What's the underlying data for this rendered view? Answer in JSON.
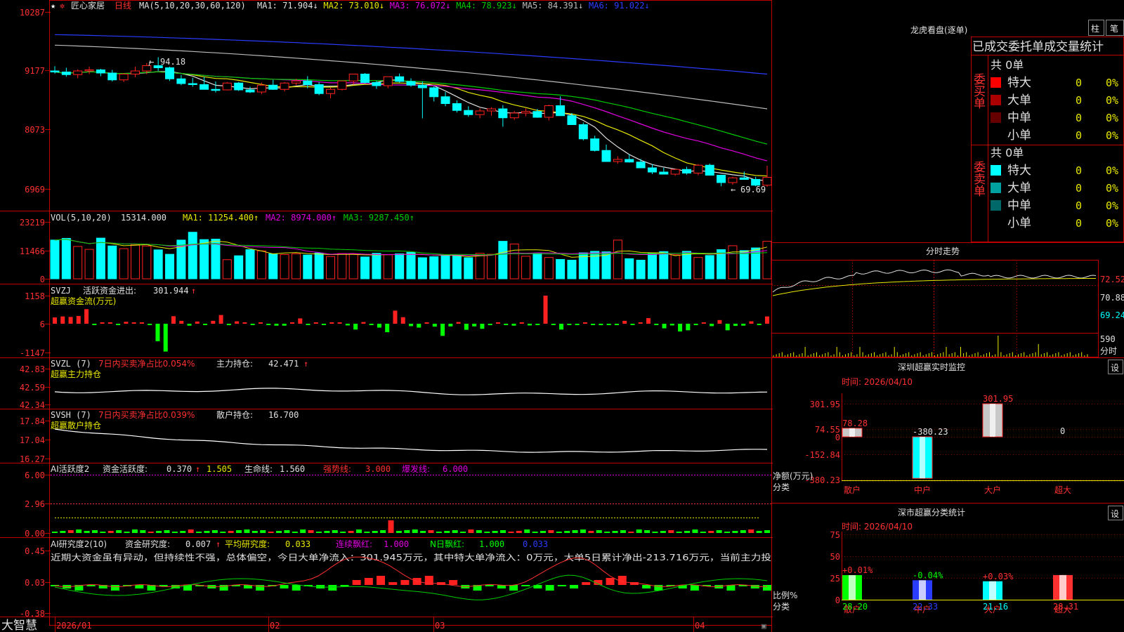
{
  "stock": {
    "name": "匠心家居",
    "period": "日线",
    "ma_header": "MA(5,10,20,30,60,120)",
    "ma_items": [
      {
        "label": "MA1:",
        "value": "71.904",
        "arrow": "↓",
        "color": "#e0e0e0"
      },
      {
        "label": "MA2:",
        "value": "73.010",
        "arrow": "↓",
        "color": "#e8e800"
      },
      {
        "label": "MA3:",
        "value": "76.072",
        "arrow": "↓",
        "color": "#e000e0"
      },
      {
        "label": "MA4:",
        "value": "78.923",
        "arrow": "↓",
        "color": "#00cc00"
      },
      {
        "label": "MA5:",
        "value": "84.391",
        "arrow": "↓",
        "color": "#bbbbbb"
      },
      {
        "label": "MA6:",
        "value": "91.022",
        "arrow": "↓",
        "color": "#2a3cff"
      }
    ],
    "high_label": "94.18",
    "low_label": "69.69"
  },
  "price_axis": [
    "10287",
    "9177",
    "8073",
    "6969"
  ],
  "price_range": [
    66.0,
    104.0
  ],
  "colors": {
    "up": "#ff2020",
    "down": "#00ffff",
    "frame": "#c00000",
    "grid": "#800000"
  },
  "vol_panel": {
    "header": "VOL(5,10,20)",
    "value": "15314.000",
    "items": [
      {
        "label": "MA1:",
        "value": "11254.400",
        "arrow": "↑",
        "color": "#e8e800"
      },
      {
        "label": "MA2:",
        "value": "8974.000",
        "arrow": "↑",
        "color": "#e000e0"
      },
      {
        "label": "MA3:",
        "value": "9287.450",
        "arrow": "↑",
        "color": "#00cc00"
      }
    ],
    "axis": [
      "23219",
      "11466",
      "0"
    ]
  },
  "svzj_panel": {
    "header": "SVZJ",
    "label": "活跃资金进出:",
    "value": "301.944",
    "arrow": "↑",
    "subtitle": "超赢资金流(万元)",
    "axis": [
      "1158",
      "6",
      "-1147"
    ]
  },
  "svzl_panel": {
    "header": "SVZL (7)",
    "text1": "7日内买卖净占比0.054%",
    "label": "主力持仓:",
    "value": "42.471",
    "arrow": "↑",
    "subtitle": "超赢主力持仓",
    "axis": [
      "42.83",
      "42.59",
      "42.34"
    ]
  },
  "svsh_panel": {
    "header": "SVSH (7)",
    "text1": "7日内买卖净占比0.039%",
    "label": "散户持仓:",
    "value": "16.700",
    "arrow": "↑",
    "subtitle": "超赢散户持仓",
    "axis": [
      "17.84",
      "17.04",
      "16.27"
    ]
  },
  "ai_active_panel": {
    "header": "AI活跃度2",
    "label": "资金活跃度:",
    "value": "0.370",
    "arrow": "↑",
    "value2": "1.505",
    "label3": "生命线:",
    "value3": "1.560",
    "label4": "强势线:",
    "value4": "3.000",
    "label5": "爆发线:",
    "value5": "6.000",
    "axis": [
      "6.00",
      "2.96",
      "0.00"
    ]
  },
  "ai_research_panel": {
    "header": "AI研究度2(10)",
    "label": "资金研究度:",
    "value": "0.007",
    "arrow": "↑",
    "label2": "平均研究度:",
    "value2": "0.033",
    "label3": "连续飘红:",
    "value3": "1.000",
    "label4": "N日飘红:",
    "value4": "1.000",
    "value5": "0.033",
    "comment": "近期大资金虽有异动，但持续性不强，总体偏空，今日大单净流入：301.945万元，其中特大单净流入：0万元，大单5日累计净出-213.716万元，当前主力投",
    "axis": [
      "0.45",
      "0.03",
      "-0.38"
    ]
  },
  "date_axis": [
    "2026/01",
    "02",
    "03",
    "04"
  ],
  "brand": "大智慧",
  "right": {
    "dragon_title": "龙虎看盘(逐单)",
    "tab1": "柱",
    "tab2": "笔",
    "stat_title": "已成交委托单成交量统计",
    "buy_side": {
      "label": "委买单",
      "total": "共 0单",
      "rows": [
        {
          "name": "特大",
          "value": "0",
          "pct": "0%",
          "color": "#ff0000"
        },
        {
          "name": "大单",
          "value": "0",
          "pct": "0%",
          "color": "#aa0000"
        },
        {
          "name": "中单",
          "value": "0",
          "pct": "0%",
          "color": "#660000"
        },
        {
          "name": "小单",
          "value": "0",
          "pct": "0%",
          "color": "#000000"
        }
      ]
    },
    "sell_side": {
      "label": "委卖单",
      "total": "共 0单",
      "rows": [
        {
          "name": "特大",
          "value": "0",
          "pct": "0%",
          "color": "#00ffff"
        },
        {
          "name": "大单",
          "value": "0",
          "pct": "0%",
          "color": "#00a0a0"
        },
        {
          "name": "中单",
          "value": "0",
          "pct": "0%",
          "color": "#006868"
        },
        {
          "name": "小单",
          "value": "0",
          "pct": "0%",
          "color": "#000000"
        }
      ]
    },
    "intraday_title": "分时走势",
    "intraday_axis": [
      "72.52",
      "70.88",
      "69.24"
    ],
    "intraday_vol_axis": [
      "590",
      "分时"
    ],
    "monitor": {
      "title": "深圳超赢实时监控",
      "set": "设",
      "time": "时间: 2026/04/10",
      "axis": [
        "301.95",
        "74.55",
        "0",
        "-152.84",
        "-380.23"
      ],
      "ylabel": "净额(万元)",
      "xlabel": "分类",
      "categories": [
        "散户",
        "中户",
        "大户",
        "超大"
      ],
      "values": [
        78.28,
        -380.23,
        301.95,
        0
      ],
      "value_labels": [
        "78.28",
        "-380.23",
        "301.95",
        "0"
      ]
    },
    "classify": {
      "title": "深市超赢分类统计",
      "set": "设",
      "time": "时间: 2026/04/10",
      "axis": [
        "75",
        "50",
        "25",
        "0"
      ],
      "ylabel": "比例%",
      "xlabel": "分类",
      "categories": [
        "散户",
        "中户",
        "大户",
        "超大"
      ],
      "values": [
        28.2,
        22.33,
        21.16,
        28.31
      ],
      "changes": [
        "+0.01%",
        "-0.04%",
        "+0.03%",
        ""
      ],
      "value_labels": [
        "28.20",
        "22.33",
        "21.16",
        "28.31"
      ]
    }
  },
  "chart_data": [
    {
      "type": "candlestick",
      "title": "匠心家居 日线",
      "x": [
        "2026/01",
        "02",
        "03",
        "04"
      ],
      "ohlc": [
        [
          91.6,
          92.5,
          91.1,
          91.4
        ],
        [
          91.4,
          92.2,
          90.5,
          90.9
        ],
        [
          90.9,
          91.9,
          90.2,
          91.6
        ],
        [
          91.6,
          92.4,
          91.0,
          91.8
        ],
        [
          91.8,
          92.0,
          90.6,
          91.2
        ],
        [
          91.2,
          91.8,
          89.6,
          89.9
        ],
        [
          89.9,
          91.2,
          89.5,
          91.0
        ],
        [
          91.0,
          92.4,
          90.4,
          91.6
        ],
        [
          91.6,
          93.1,
          91.0,
          92.6
        ],
        [
          92.6,
          94.2,
          91.6,
          92.2
        ],
        [
          92.2,
          92.4,
          89.7,
          90.1
        ],
        [
          90.1,
          90.8,
          88.9,
          89.2
        ],
        [
          89.2,
          90.3,
          88.6,
          89.0
        ],
        [
          89.0,
          90.5,
          88.2,
          88.1
        ],
        [
          88.1,
          89.6,
          87.5,
          88.0
        ],
        [
          88.0,
          89.5,
          87.9,
          89.3
        ],
        [
          89.3,
          89.5,
          87.8,
          88.0
        ],
        [
          88.0,
          88.6,
          87.4,
          87.6
        ],
        [
          87.6,
          89.4,
          87.2,
          88.9
        ],
        [
          88.9,
          89.9,
          88.0,
          88.1
        ],
        [
          88.1,
          89.5,
          87.7,
          89.3
        ],
        [
          89.3,
          90.1,
          88.9,
          89.7
        ],
        [
          89.7,
          90.6,
          88.3,
          89.0
        ],
        [
          89.0,
          89.5,
          87.0,
          87.3
        ],
        [
          87.3,
          88.4,
          86.4,
          88.1
        ],
        [
          88.1,
          89.3,
          87.9,
          89.7
        ],
        [
          89.7,
          90.8,
          89.0,
          91.0
        ],
        [
          91.0,
          91.2,
          89.2,
          89.4
        ],
        [
          89.4,
          89.7,
          88.2,
          88.8
        ],
        [
          88.8,
          90.3,
          88.3,
          90.5
        ],
        [
          90.5,
          91.1,
          89.4,
          89.6
        ],
        [
          89.6,
          90.2,
          88.6,
          88.9
        ],
        [
          88.9,
          89.6,
          82.6,
          88.4
        ],
        [
          88.4,
          88.7,
          85.8,
          86.7
        ],
        [
          86.7,
          87.6,
          84.9,
          85.4
        ],
        [
          85.4,
          86.0,
          83.7,
          84.1
        ],
        [
          84.1,
          84.9,
          82.9,
          83.3
        ],
        [
          83.3,
          84.5,
          82.6,
          84.0
        ],
        [
          84.0,
          84.7,
          83.1,
          84.4
        ],
        [
          84.4,
          85.1,
          81.0,
          82.7
        ],
        [
          82.7,
          84.0,
          82.3,
          83.6
        ],
        [
          83.6,
          84.5,
          83.0,
          83.9
        ],
        [
          83.9,
          84.4,
          82.7,
          82.8
        ],
        [
          82.8,
          85.2,
          82.2,
          85.0
        ],
        [
          85.0,
          86.8,
          83.8,
          83.1
        ],
        [
          83.1,
          83.6,
          82.1,
          81.4
        ],
        [
          81.4,
          81.8,
          78.4,
          78.7
        ],
        [
          78.7,
          79.3,
          76.3,
          76.5
        ],
        [
          76.5,
          77.6,
          76.2,
          74.4
        ],
        [
          74.4,
          75.4,
          74.0,
          74.8
        ],
        [
          74.8,
          75.8,
          74.2,
          74.3
        ],
        [
          74.3,
          74.9,
          73.4,
          73.2
        ],
        [
          73.2,
          73.9,
          72.0,
          72.4
        ],
        [
          72.4,
          73.2,
          72.0,
          72.0
        ],
        [
          72.0,
          73.0,
          71.7,
          72.9
        ],
        [
          72.9,
          73.4,
          71.9,
          72.2
        ],
        [
          72.2,
          73.9,
          71.8,
          73.7
        ],
        [
          73.7,
          74.0,
          72.0,
          71.8
        ],
        [
          71.8,
          71.9,
          69.7,
          70.4
        ],
        [
          70.4,
          71.5,
          70.0,
          71.3
        ],
        [
          71.3,
          72.5,
          71.1,
          71.0
        ],
        [
          71.0,
          71.5,
          69.7,
          69.9
        ],
        [
          69.9,
          73.6,
          69.6,
          71.4
        ]
      ]
    },
    {
      "type": "bar",
      "title": "VOL(5,10,20)",
      "values": [
        15800,
        16500,
        13200,
        12000,
        16600,
        13400,
        12300,
        14000,
        13400,
        11800,
        10000,
        15800,
        19000,
        16000,
        16200,
        7800,
        9400,
        11900,
        11400,
        10200,
        9900,
        10200,
        9700,
        10500,
        9100,
        10300,
        10100,
        8900,
        10400,
        9800,
        10200,
        10800,
        8600,
        9000,
        9400,
        9600,
        8600,
        10400,
        10000,
        15300,
        14200,
        9200,
        10400,
        8700,
        7900,
        7600,
        10600,
        11200,
        11000,
        15800,
        8200,
        7600,
        10400,
        11100,
        9800,
        11200,
        8700,
        9500,
        11900,
        13500,
        11500,
        12600,
        15300
      ]
    },
    {
      "type": "bar",
      "title": "超赢资金流(万元)",
      "values": [
        260,
        300,
        280,
        320,
        600,
        -50,
        20,
        0,
        -30,
        80,
        40,
        30,
        -20,
        -720,
        -1147,
        310,
        120,
        -80,
        90,
        -40,
        120,
        360,
        -60,
        100,
        30,
        -10,
        30,
        -10,
        -80,
        -80,
        20,
        220,
        -10,
        40,
        -50,
        60,
        20,
        -70,
        -240,
        70,
        -50,
        -160,
        -350,
        540,
        270,
        -100,
        -160,
        40,
        -120,
        -500,
        -110,
        70,
        -250,
        -110,
        -210,
        -60,
        40,
        -30,
        -80,
        60,
        -70,
        -40,
        1158,
        -30,
        -240,
        -40,
        -40,
        10,
        -40,
        -60,
        -40,
        -40,
        120,
        -30,
        30,
        230,
        -10,
        -190,
        -70,
        -320,
        -270,
        -60,
        40,
        -100,
        150,
        -270,
        -90,
        -80,
        100,
        -40,
        300
      ]
    }
  ]
}
